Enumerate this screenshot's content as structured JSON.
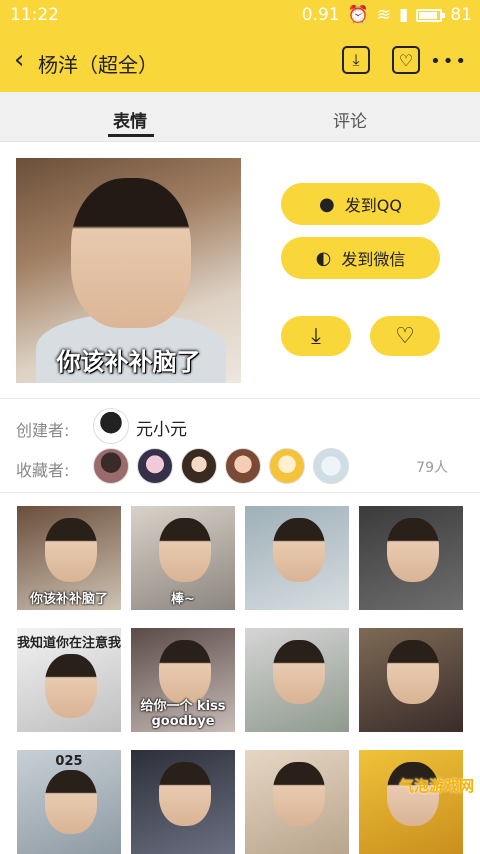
{
  "status": {
    "time": "11:22",
    "network_speed": "0.91",
    "battery": "81"
  },
  "header": {
    "back_glyph": "‹",
    "title": "杨洋（超全）",
    "download_icon": "download-icon",
    "favorite_icon": "favorite-box-icon",
    "more_glyph": "•••"
  },
  "tabs": [
    {
      "label": "表情",
      "active": true
    },
    {
      "label": "评论",
      "active": false
    }
  ],
  "sticker": {
    "caption": "你该补补脑了"
  },
  "actions": {
    "send_qq": "发到QQ",
    "send_wechat": "发到微信",
    "download_icon": "download-icon",
    "like_icon": "heart-icon"
  },
  "creator": {
    "label": "创建者:",
    "name": "元小元"
  },
  "collectors": {
    "label": "收藏者:",
    "count": "79人"
  },
  "grid": [
    {
      "caption": "你该补补脑了",
      "pos": "bottom"
    },
    {
      "caption": "棒~",
      "pos": "bottom"
    },
    {
      "caption": "",
      "pos": "bottom"
    },
    {
      "caption": "",
      "pos": "bottom"
    },
    {
      "caption": "我知道你在注意我",
      "pos": "top"
    },
    {
      "caption": "给你一个 kiss goodbye",
      "pos": "bottom"
    },
    {
      "caption": "",
      "pos": "bottom"
    },
    {
      "caption": "",
      "pos": "bottom"
    },
    {
      "caption": "025",
      "pos": "top"
    },
    {
      "caption": "",
      "pos": "bottom"
    },
    {
      "caption": "",
      "pos": "bottom"
    },
    {
      "caption": "",
      "pos": "bottom"
    }
  ],
  "watermark": "气泡游戏网",
  "colors": {
    "accent": "#f9d63a"
  }
}
